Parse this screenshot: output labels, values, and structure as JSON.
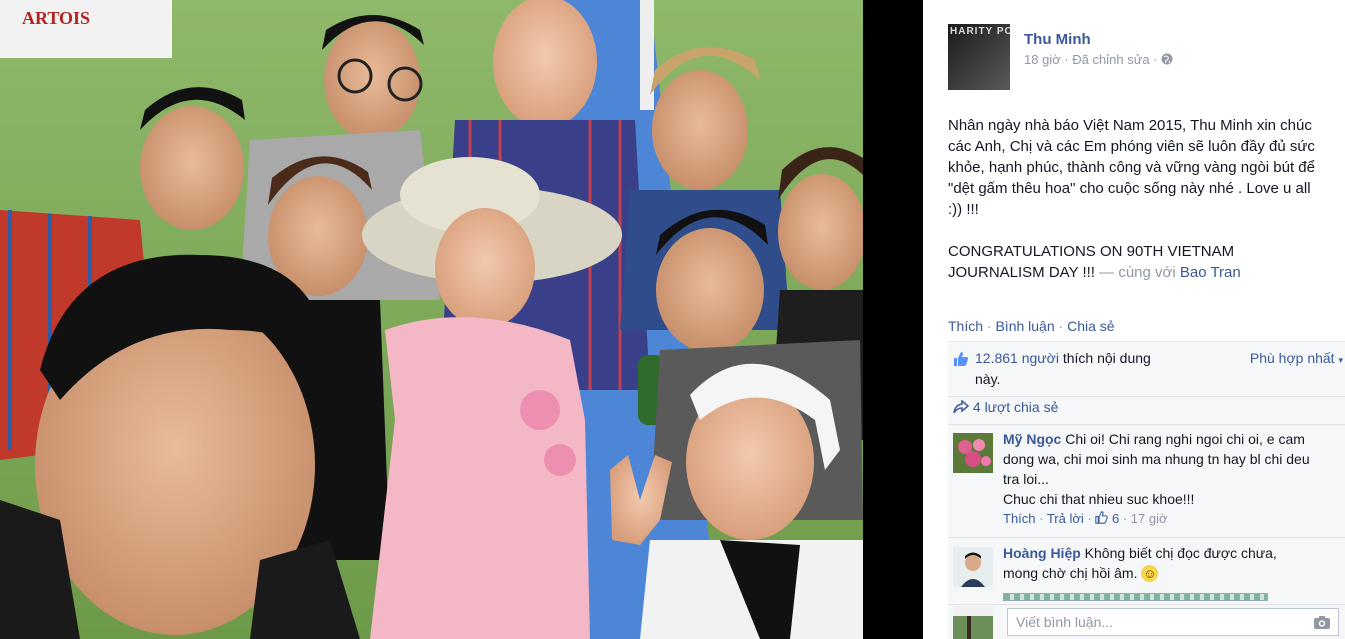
{
  "post": {
    "author": "Thu Minh",
    "avatar_text": "HARITY PO",
    "time": "18 giờ",
    "edited": "Đã chỉnh sửa",
    "privacy_icon": "globe-icon",
    "body_lines": [
      "Nhân ngày nhà báo Việt Nam 2015, Thu Minh xin chúc",
      "các Anh, Chị và các Em phóng viên sẽ luôn đầy đủ sức",
      "khỏe, hạnh phúc, thành công và vững vàng ngòi bút để",
      "\"dệt gấm thêu hoa\" cho cuộc sống này nhé . Love u all",
      ":)) !!!"
    ],
    "congrats_lines": [
      "CONGRATULATIONS ON 90TH VIETNAM",
      "JOURNALISM DAY !!!"
    ],
    "with_text": " — cùng với ",
    "with_person": "Bao Tran"
  },
  "actions": {
    "like": "Thích",
    "comment": "Bình luận",
    "share": "Chia sẻ",
    "dot": " · "
  },
  "likes": {
    "count": "12.861 người",
    "rest_1": " thích nội dung",
    "rest_2": "này.",
    "sort": "Phù hợp nhất"
  },
  "shares": {
    "text": "4 lượt chia sẻ"
  },
  "comments": [
    {
      "author": "Mỹ Ngọc",
      "lines": [
        "Chi oi! Chi rang nghi ngoi chi oi, e cam",
        "dong wa, chi moi sinh ma nhung tn hay bl chi deu",
        "tra loi...",
        "Chuc chi that nhieu suc khoe!!!"
      ],
      "like": "Thích",
      "reply": "Trả lời",
      "likes": "6",
      "time": "17 giờ"
    },
    {
      "author": "Hoàng Hiệp",
      "lines": [
        "Không biết chị đọc được chưa,",
        "mong chờ chị hồi âm."
      ],
      "emoji": "☺"
    }
  ],
  "composer": {
    "placeholder": "Viết bình luận..."
  },
  "colors": {
    "link": "#3b5998",
    "grey": "#9197a3",
    "panel": "#f6f7f9"
  },
  "photo": {
    "banner": "ARTOIS"
  }
}
